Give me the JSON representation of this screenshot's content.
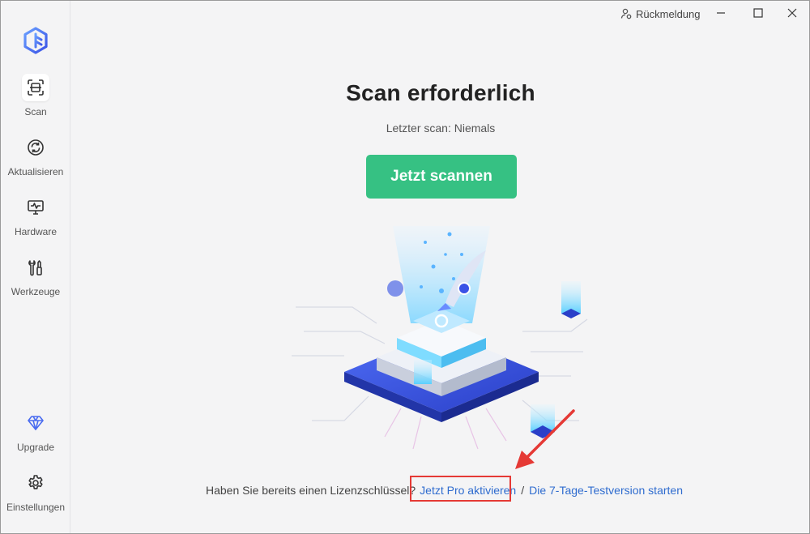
{
  "sidebar": {
    "items": [
      {
        "label": "Scan",
        "icon": "scan-icon"
      },
      {
        "label": "Aktualisieren",
        "icon": "refresh-icon"
      },
      {
        "label": "Hardware",
        "icon": "monitor-icon"
      },
      {
        "label": "Werkzeuge",
        "icon": "tools-icon"
      }
    ],
    "bottom_items": [
      {
        "label": "Upgrade",
        "icon": "diamond-icon"
      },
      {
        "label": "Einstellungen",
        "icon": "gear-icon"
      }
    ]
  },
  "topbar": {
    "feedback_label": "Rückmeldung"
  },
  "main": {
    "title": "Scan erforderlich",
    "last_scan": "Letzter scan: Niemals",
    "scan_button": "Jetzt scannen"
  },
  "license": {
    "question": "Haben Sie bereits einen Lizenzschlüssel?",
    "activate_link": "Jetzt Pro aktivieren",
    "separator": "/",
    "trial_link": "Die 7-Tage-Testversion starten"
  },
  "colors": {
    "accent_green": "#36c183",
    "link_blue": "#2f6ccf",
    "annotation_red": "#e53935",
    "logo_blue": "#4a6cf0"
  }
}
